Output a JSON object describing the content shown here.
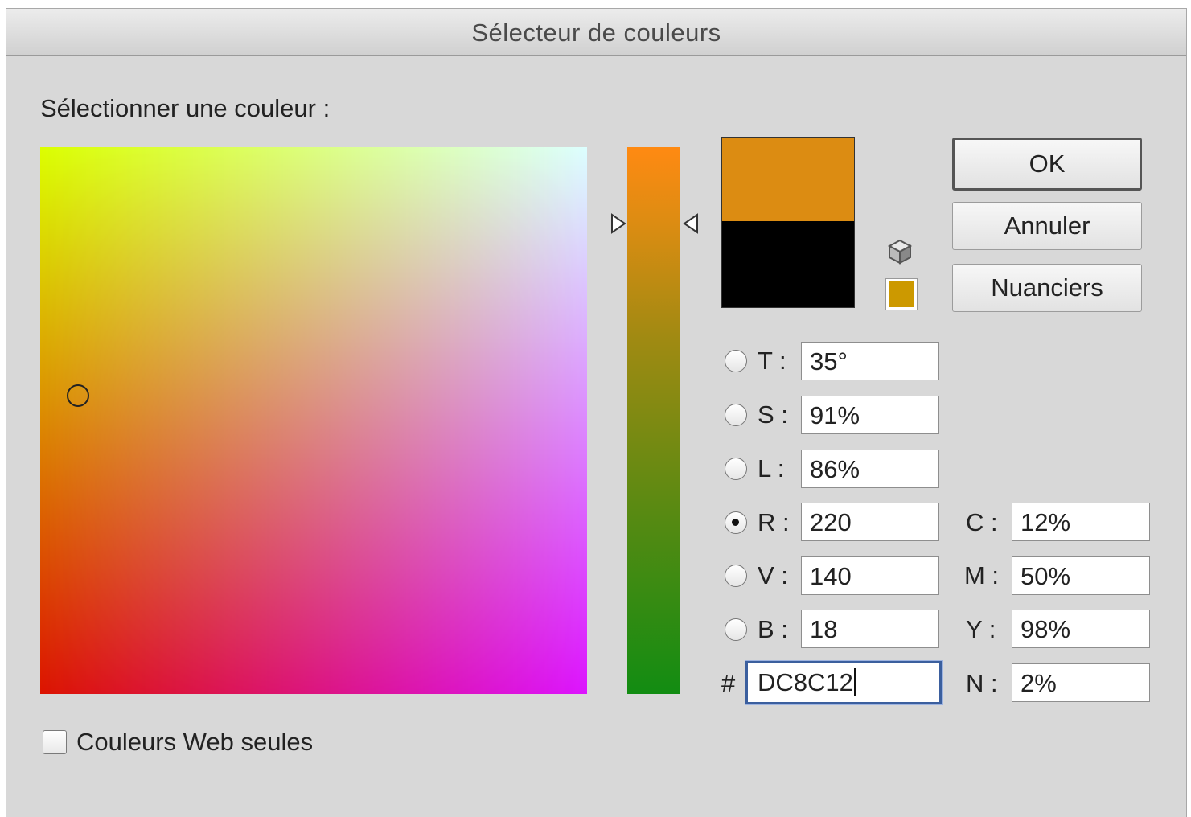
{
  "window": {
    "title": "Sélecteur de couleurs"
  },
  "prompt": "Sélectionner une couleur :",
  "colors": {
    "new": "#dc8c12",
    "old": "#000000",
    "web_safe": "#cc9900"
  },
  "buttons": {
    "ok": "OK",
    "cancel": "Annuler",
    "swatches": "Nuanciers"
  },
  "hsb": [
    {
      "label": "T :",
      "value": "35°",
      "selected": false
    },
    {
      "label": "S :",
      "value": "91%",
      "selected": false
    },
    {
      "label": "L :",
      "value": "86%",
      "selected": false
    }
  ],
  "rgb": [
    {
      "label": "R :",
      "value": "220",
      "selected": true
    },
    {
      "label": "V :",
      "value": "140",
      "selected": false
    },
    {
      "label": "B :",
      "value": "18",
      "selected": false
    }
  ],
  "cmyk": [
    {
      "label": "C :",
      "value": "12%"
    },
    {
      "label": "M :",
      "value": "50%"
    },
    {
      "label": "Y :",
      "value": "98%"
    },
    {
      "label": "N :",
      "value": "2%"
    }
  ],
  "hex": {
    "label": "#",
    "value": "DC8C12"
  },
  "web_only": {
    "label": "Couleurs Web seules",
    "checked": false
  }
}
